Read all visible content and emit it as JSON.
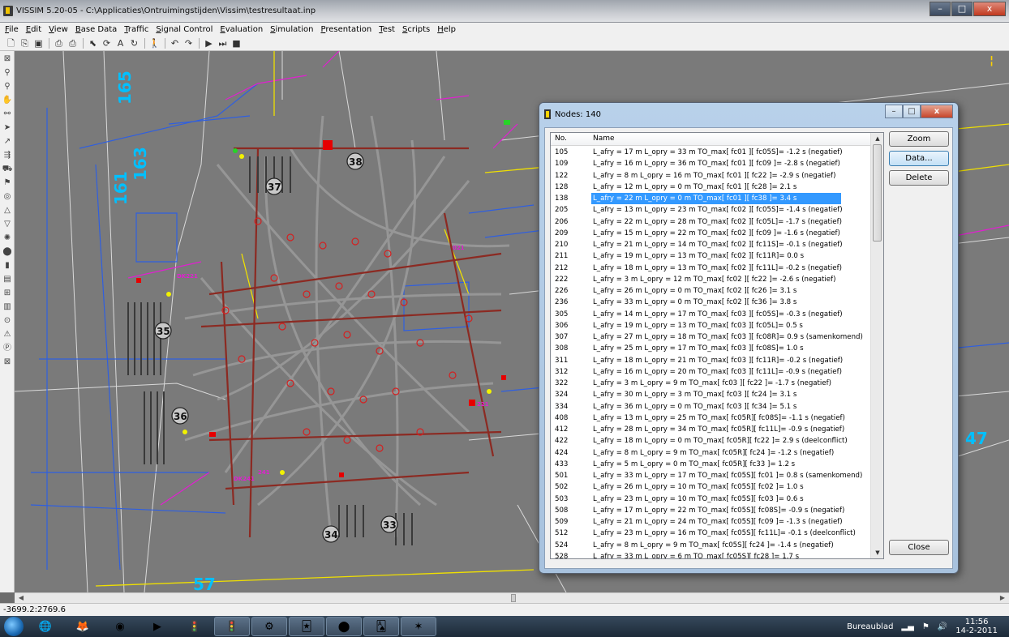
{
  "window": {
    "title": "VISSIM 5.20-05 - C:\\Applicaties\\Ontruimingstijden\\Vissim\\testresultaat.inp",
    "minimize": "–",
    "maximize": "□",
    "close": "x"
  },
  "menu": [
    "File",
    "Edit",
    "View",
    "Base Data",
    "Traffic",
    "Signal Control",
    "Evaluation",
    "Simulation",
    "Presentation",
    "Test",
    "Scripts",
    "Help"
  ],
  "toolbar_icons": [
    "new-icon",
    "open-icon",
    "save-icon",
    "print-preview-icon",
    "print-icon",
    "select-icon",
    "rotate-icon",
    "text-icon",
    "refresh-icon",
    "pedestrian-icon",
    "undo-icon",
    "redo-icon",
    "play-icon",
    "step-icon",
    "stop-icon"
  ],
  "left_tools": [
    "zoom-window-icon",
    "zoom-in-icon",
    "zoom-out-icon",
    "pan-icon",
    "links-icon",
    "connectors-icon",
    "routes-icon",
    "vehicle-inputs-icon",
    "parking-icon",
    "signal-icon",
    "detector-icon",
    "stop-sign-icon",
    "priority-icon",
    "conflict-icon",
    "node-icon",
    "travel-time-icon",
    "queue-icon",
    "data-collection-icon",
    "sections-icon",
    "traffic-light-icon",
    "bus-stop-icon",
    "parking-lot-icon",
    "grid-icon"
  ],
  "canvas": {
    "labels": [
      "165",
      "163",
      "161",
      "37",
      "38",
      "35",
      "36",
      "34",
      "33",
      "47",
      "57",
      "DK221",
      "DK241",
      "221",
      "241",
      "021"
    ],
    "status": "-3699.2:2769.6"
  },
  "dialog": {
    "title": "Nodes: 140",
    "col_no": "No.",
    "col_name": "Name",
    "buttons": {
      "zoom": "Zoom",
      "data": "Data...",
      "delete": "Delete",
      "close": "Close"
    },
    "selected_no": "138",
    "rows": [
      {
        "no": "105",
        "name": "L_afry =  17 m  L_opry = 33 m  TO_max[ fc01 ][ fc05S]= -1.2 s (negatief)"
      },
      {
        "no": "109",
        "name": "L_afry =  16 m  L_opry = 36 m  TO_max[ fc01 ][ fc09 ]= -2.8 s (negatief)"
      },
      {
        "no": "122",
        "name": "L_afry =   8 m  L_opry = 16 m  TO_max[ fc01 ][ fc22 ]= -2.9 s (negatief)"
      },
      {
        "no": "128",
        "name": "L_afry =  12 m  L_opry =  0 m  TO_max[ fc01 ][ fc28 ]= 2.1 s"
      },
      {
        "no": "138",
        "name": "L_afry =  22 m  L_opry =  0 m  TO_max[ fc01 ][ fc38 ]= 3.4 s"
      },
      {
        "no": "205",
        "name": "L_afry =  13 m  L_opry = 23 m  TO_max[ fc02 ][ fc05S]= -1.4 s (negatief)"
      },
      {
        "no": "206",
        "name": "L_afry =  22 m  L_opry = 28 m  TO_max[ fc02 ][ fc05L]= -1.7 s (negatief)"
      },
      {
        "no": "209",
        "name": "L_afry =  15 m  L_opry = 22 m  TO_max[ fc02 ][ fc09 ]= -1.6 s (negatief)"
      },
      {
        "no": "210",
        "name": "L_afry =  21 m  L_opry = 14 m  TO_max[ fc02 ][ fc11S]= -0.1 s (negatief)"
      },
      {
        "no": "211",
        "name": "L_afry =  19 m  L_opry = 13 m  TO_max[ fc02 ][ fc11R]= 0.0 s"
      },
      {
        "no": "212",
        "name": "L_afry =  18 m  L_opry = 13 m  TO_max[ fc02 ][ fc11L]= -0.2 s (negatief)"
      },
      {
        "no": "222",
        "name": "L_afry =   3 m  L_opry = 12 m  TO_max[ fc02 ][ fc22 ]= -2.6 s (negatief)"
      },
      {
        "no": "226",
        "name": "L_afry =  26 m  L_opry =  0 m  TO_max[ fc02 ][ fc26 ]= 3.1 s"
      },
      {
        "no": "236",
        "name": "L_afry =  33 m  L_opry =  0 m  TO_max[ fc02 ][ fc36 ]= 3.8 s"
      },
      {
        "no": "305",
        "name": "L_afry =  14 m  L_opry = 17 m  TO_max[ fc03 ][ fc05S]= -0.3 s (negatief)"
      },
      {
        "no": "306",
        "name": "L_afry =  19 m  L_opry = 13 m  TO_max[ fc03 ][ fc05L]= 0.5 s"
      },
      {
        "no": "307",
        "name": "L_afry =  27 m  L_opry = 18 m  TO_max[ fc03 ][ fc08R]= 0.9 s (samenkomend)"
      },
      {
        "no": "308",
        "name": "L_afry =  25 m  L_opry = 17 m  TO_max[ fc03 ][ fc08S]= 1.0 s"
      },
      {
        "no": "311",
        "name": "L_afry =  18 m  L_opry = 21 m  TO_max[ fc03 ][ fc11R]= -0.2 s (negatief)"
      },
      {
        "no": "312",
        "name": "L_afry =  16 m  L_opry = 20 m  TO_max[ fc03 ][ fc11L]= -0.9 s (negatief)"
      },
      {
        "no": "322",
        "name": "L_afry =   3 m  L_opry =  9 m  TO_max[ fc03 ][ fc22 ]= -1.7 s (negatief)"
      },
      {
        "no": "324",
        "name": "L_afry =  30 m  L_opry =  3 m  TO_max[ fc03 ][ fc24 ]= 3.1 s"
      },
      {
        "no": "334",
        "name": "L_afry =  36 m  L_opry =  0 m  TO_max[ fc03 ][ fc34 ]= 5.1 s"
      },
      {
        "no": "408",
        "name": "L_afry =  13 m  L_opry = 25 m  TO_max[ fc05R][ fc08S]= -1.1 s (negatief)"
      },
      {
        "no": "412",
        "name": "L_afry =  28 m  L_opry = 34 m  TO_max[ fc05R][ fc11L]= -0.9 s (negatief)"
      },
      {
        "no": "422",
        "name": "L_afry =  18 m  L_opry =  0 m  TO_max[ fc05R][ fc22 ]= 2.9 s (deelconflict)"
      },
      {
        "no": "424",
        "name": "L_afry =   8 m  L_opry =  9 m  TO_max[ fc05R][ fc24 ]= -1.2 s (negatief)"
      },
      {
        "no": "433",
        "name": "L_afry =   5 m  L_opry =  0 m  TO_max[ fc05R][ fc33 ]= 1.2 s"
      },
      {
        "no": "501",
        "name": "L_afry =  33 m  L_opry = 17 m  TO_max[ fc05S][ fc01 ]= 0.8 s (samenkomend)"
      },
      {
        "no": "502",
        "name": "L_afry =  26 m  L_opry = 10 m  TO_max[ fc05S][ fc02 ]= 1.0 s"
      },
      {
        "no": "503",
        "name": "L_afry =  23 m  L_opry = 10 m  TO_max[ fc05S][ fc03 ]= 0.6 s"
      },
      {
        "no": "508",
        "name": "L_afry =  17 m  L_opry = 22 m  TO_max[ fc05S][ fc08S]= -0.9 s (negatief)"
      },
      {
        "no": "509",
        "name": "L_afry =  21 m  L_opry = 24 m  TO_max[ fc05S][ fc09 ]= -1.3 s (negatief)"
      },
      {
        "no": "512",
        "name": "L_afry =  23 m  L_opry = 16 m  TO_max[ fc05S][ fc11L]= -0.1 s (deelconflict)"
      },
      {
        "no": "524",
        "name": "L_afry =   8 m  L_opry =  9 m  TO_max[ fc05S][ fc24 ]= -1.4 s (negatief)"
      },
      {
        "no": "528",
        "name": "L_afry =  33 m  L_opry =  6 m  TO_max[ fc05S][ fc28 ]= 1.7 s"
      }
    ]
  },
  "taskbar": {
    "apps": [
      "ie-icon",
      "firefox-icon",
      "media-icon",
      "tool-icon",
      "traffic-light-icon",
      "vissim-icon",
      "utility-icon",
      "cards-icon",
      "green-icon",
      "solitaire-icon",
      "red-app-icon"
    ],
    "tray_label": "Bureaublad",
    "time": "11:56",
    "date": "14-2-2011"
  }
}
